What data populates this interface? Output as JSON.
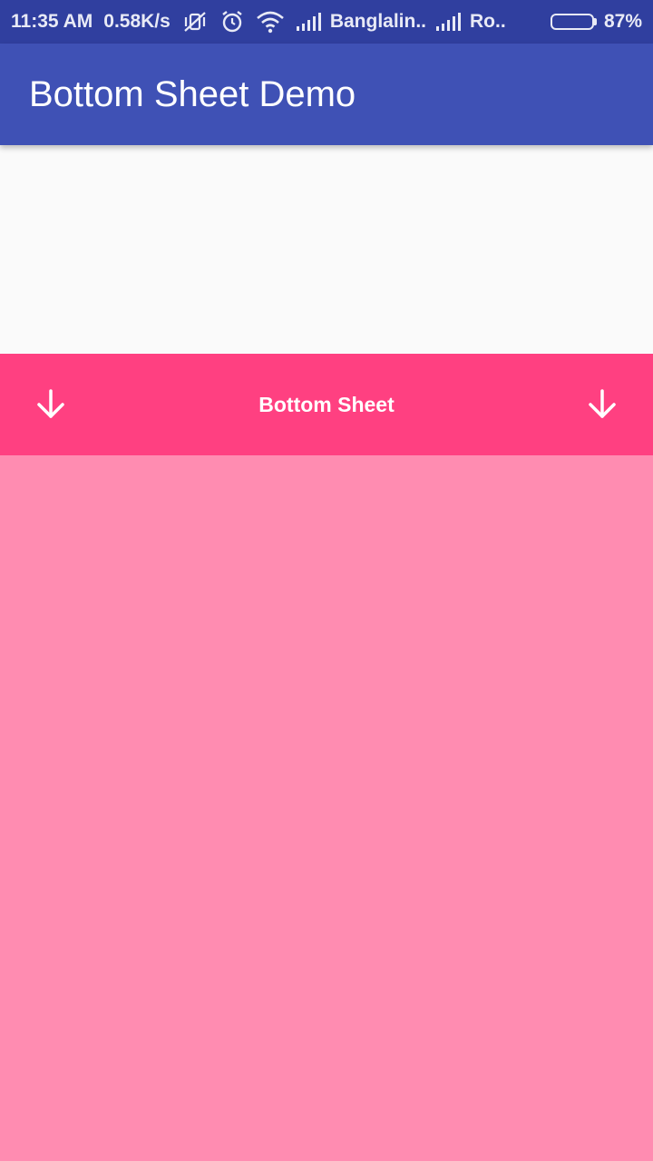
{
  "status_bar": {
    "time": "11:35 AM",
    "speed": "0.58K/s",
    "carrier1": "Banglalin..",
    "carrier2": "Ro..",
    "battery_percent": "87%",
    "battery_level": 0.87,
    "icons": [
      "vibrate-off-icon",
      "alarm-icon",
      "wifi-icon",
      "signal-icon",
      "signal-icon",
      "battery-icon"
    ]
  },
  "app_bar": {
    "title": "Bottom Sheet Demo"
  },
  "bottom_sheet": {
    "title": "Bottom Sheet",
    "left_icon": "arrow-down-icon",
    "right_icon": "arrow-down-icon"
  },
  "colors": {
    "status_bar": "#303F9F",
    "app_bar": "#3F51B5",
    "sheet_header": "#FF4081",
    "sheet_body": "#FF8CB1",
    "background": "#FAFAFA"
  }
}
